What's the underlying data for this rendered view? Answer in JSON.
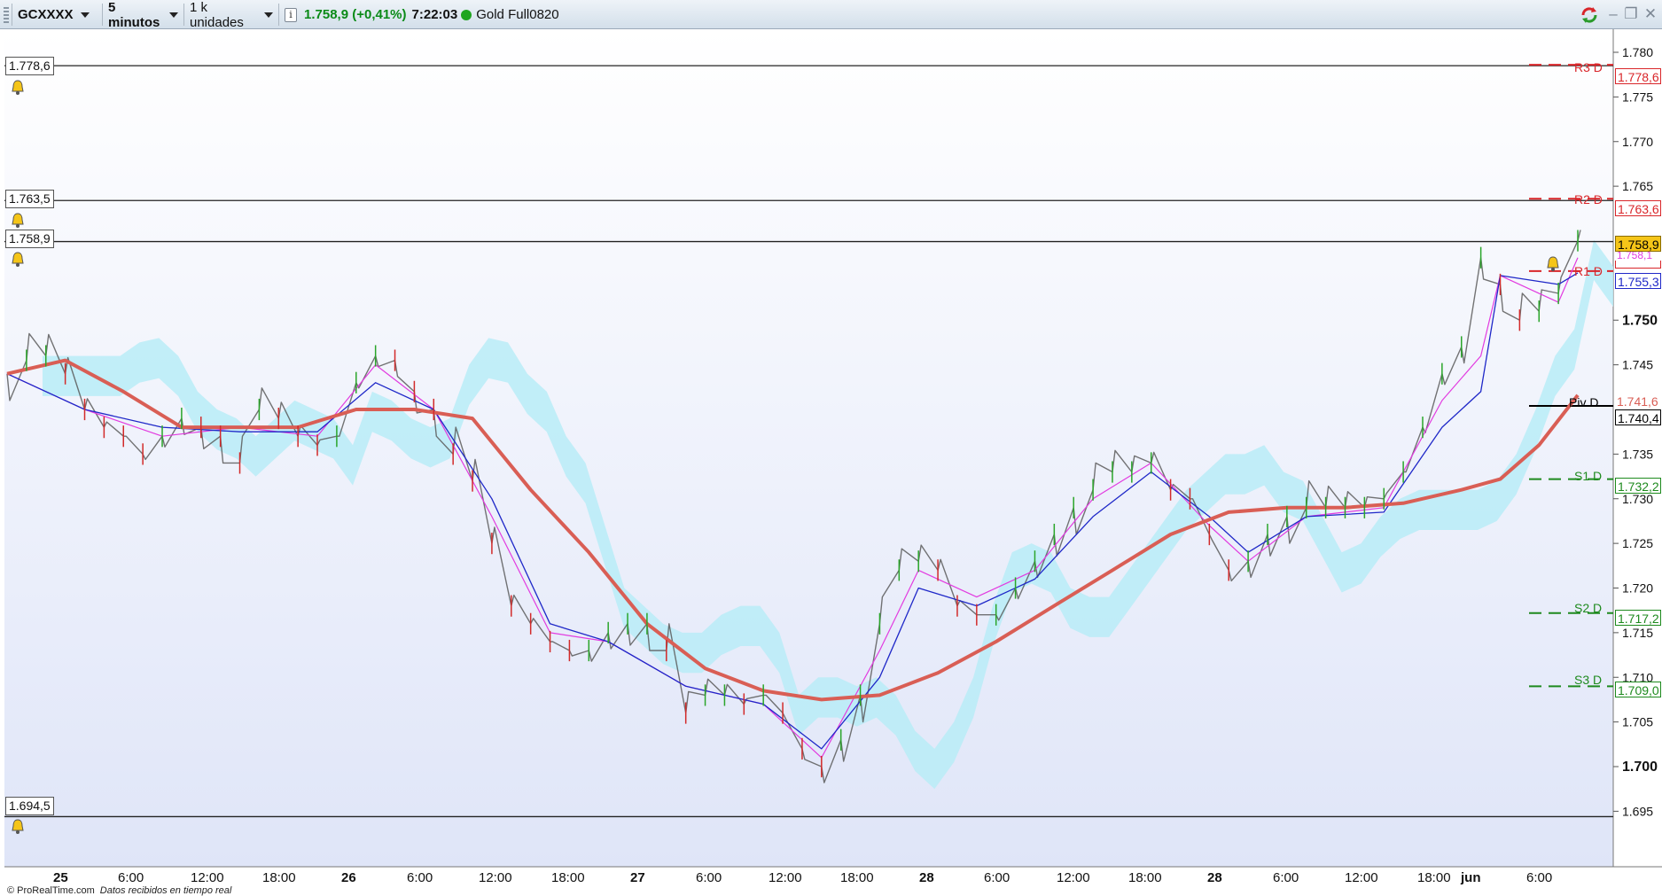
{
  "toolbar": {
    "symbol": "GCXXXX",
    "timeframe": "5 minutos",
    "units": "1 k unidades",
    "info_icon": "info-icon",
    "last_price": "1.758,9",
    "change": "(+0,41%)",
    "time": "7:22:03",
    "instrument": "Gold Full0820",
    "window_controls": [
      "refresh-icon",
      "minimize-icon",
      "restore-icon",
      "close-icon"
    ]
  },
  "horizontal_lines": [
    {
      "label": "1.778,6"
    },
    {
      "label": "1.763,5"
    },
    {
      "label": "1.758,9"
    },
    {
      "label": "1.694,5"
    }
  ],
  "pivots": [
    {
      "name": "R3 D",
      "value": "1.778,6",
      "color": "#d9262a"
    },
    {
      "name": "R2 D",
      "value": "1.763,6",
      "color": "#d9262a"
    },
    {
      "name": "R1 D",
      "value": "",
      "color": "#d9262a"
    },
    {
      "name": "Piv D",
      "value": "1.740,4",
      "color": "#000000"
    },
    {
      "name": "S1 D",
      "value": "1.732,2",
      "color": "#1e8a1e"
    },
    {
      "name": "S2 D",
      "value": "1.717,2",
      "color": "#1e8a1e"
    },
    {
      "name": "S3 D",
      "value": "1.709,0",
      "color": "#1e8a1e"
    }
  ],
  "price_tags": {
    "last": "1.758,9",
    "last_bg": "#f5c518",
    "secondary": "1.758,1",
    "kijun": "1.755,3",
    "ma": "1.741,6"
  },
  "chart_data": {
    "type": "line",
    "instrument": "GCXXXX",
    "interval": "5 minutos",
    "ylim": [
      1692,
      1783
    ],
    "y_ticks": [
      "1.780",
      "1.775",
      "1.770",
      "1.765",
      "1.750",
      "1.745",
      "1.735",
      "1.730",
      "1.725",
      "1.720",
      "1.715",
      "1.710",
      "1.705",
      "1.700",
      "1.695"
    ],
    "y_major_ticks": [
      "1.750",
      "1.700"
    ],
    "x_ticks": [
      "25",
      "6:00",
      "12:00",
      "18:00",
      "26",
      "6:00",
      "12:00",
      "18:00",
      "27",
      "6:00",
      "12:00",
      "18:00",
      "28",
      "6:00",
      "12:00",
      "18:00",
      "28",
      "6:00",
      "12:00",
      "18:00",
      "jun",
      "6:00"
    ],
    "x_day_ticks": [
      "25",
      "26",
      "27",
      "28",
      "jun"
    ],
    "series": [
      {
        "kind": "price",
        "color": "#5a5a5a",
        "points": [
          [
            0,
            1744
          ],
          [
            3,
            1745.5
          ],
          [
            6,
            1746
          ],
          [
            9,
            1744
          ],
          [
            12,
            1740
          ],
          [
            15,
            1738
          ],
          [
            18,
            1737
          ],
          [
            21,
            1735
          ],
          [
            24,
            1737
          ],
          [
            27,
            1739
          ],
          [
            30,
            1738
          ],
          [
            33,
            1737
          ],
          [
            36,
            1734
          ],
          [
            39,
            1740
          ],
          [
            42,
            1739
          ],
          [
            45,
            1737
          ],
          [
            48,
            1736
          ],
          [
            51,
            1737
          ],
          [
            54,
            1743
          ],
          [
            57,
            1746
          ],
          [
            60,
            1745.5
          ],
          [
            63,
            1742
          ],
          [
            66,
            1740
          ],
          [
            69,
            1735
          ],
          [
            72,
            1732
          ],
          [
            75,
            1725
          ],
          [
            78,
            1718
          ],
          [
            81,
            1716
          ],
          [
            84,
            1714
          ],
          [
            87,
            1713
          ],
          [
            90,
            1713
          ],
          [
            93,
            1715
          ],
          [
            96,
            1716
          ],
          [
            99,
            1716
          ],
          [
            102,
            1713
          ],
          [
            105,
            1706
          ],
          [
            108,
            1708
          ],
          [
            111,
            1708
          ],
          [
            114,
            1707
          ],
          [
            117,
            1708
          ],
          [
            120,
            1706
          ],
          [
            123,
            1702
          ],
          [
            126,
            1700
          ],
          [
            129,
            1703
          ],
          [
            132,
            1708
          ],
          [
            135,
            1716
          ],
          [
            138,
            1722
          ],
          [
            141,
            1723
          ],
          [
            144,
            1722
          ],
          [
            147,
            1718
          ],
          [
            150,
            1717
          ],
          [
            153,
            1717
          ],
          [
            156,
            1720
          ],
          [
            159,
            1723
          ],
          [
            162,
            1726
          ],
          [
            165,
            1729
          ],
          [
            168,
            1731
          ],
          [
            171,
            1733
          ],
          [
            174,
            1733
          ],
          [
            177,
            1734
          ],
          [
            180,
            1731
          ],
          [
            183,
            1730
          ],
          [
            186,
            1726
          ],
          [
            189,
            1722
          ],
          [
            192,
            1723
          ],
          [
            195,
            1726
          ],
          [
            198,
            1728
          ],
          [
            201,
            1729
          ],
          [
            204,
            1729
          ],
          [
            207,
            1729
          ],
          [
            210,
            1729
          ],
          [
            213,
            1730
          ],
          [
            216,
            1733
          ],
          [
            219,
            1738
          ],
          [
            222,
            1744
          ],
          [
            225,
            1747
          ],
          [
            228,
            1757
          ],
          [
            231,
            1754
          ],
          [
            234,
            1750
          ],
          [
            237,
            1751
          ],
          [
            240,
            1753
          ],
          [
            243,
            1758.9
          ]
        ]
      },
      {
        "kind": "tenkan",
        "color": "#e23be0",
        "points": [
          [
            0,
            1744
          ],
          [
            12,
            1740
          ],
          [
            24,
            1737
          ],
          [
            36,
            1738
          ],
          [
            48,
            1737
          ],
          [
            57,
            1745
          ],
          [
            66,
            1740
          ],
          [
            75,
            1728
          ],
          [
            84,
            1715
          ],
          [
            93,
            1714
          ],
          [
            105,
            1709
          ],
          [
            117,
            1707
          ],
          [
            126,
            1701
          ],
          [
            135,
            1713
          ],
          [
            141,
            1722
          ],
          [
            150,
            1719
          ],
          [
            159,
            1722
          ],
          [
            168,
            1730
          ],
          [
            177,
            1734
          ],
          [
            186,
            1727
          ],
          [
            192,
            1723
          ],
          [
            201,
            1728
          ],
          [
            213,
            1729
          ],
          [
            222,
            1741
          ],
          [
            228,
            1746
          ],
          [
            231,
            1755
          ],
          [
            240,
            1752
          ],
          [
            243,
            1757
          ]
        ]
      },
      {
        "kind": "kijun",
        "color": "#1f28c8",
        "points": [
          [
            0,
            1744
          ],
          [
            12,
            1740
          ],
          [
            24,
            1738
          ],
          [
            36,
            1737.5
          ],
          [
            48,
            1737.5
          ],
          [
            57,
            1743
          ],
          [
            66,
            1740
          ],
          [
            75,
            1730
          ],
          [
            84,
            1716
          ],
          [
            93,
            1714
          ],
          [
            105,
            1709
          ],
          [
            117,
            1707
          ],
          [
            126,
            1702
          ],
          [
            135,
            1710
          ],
          [
            141,
            1720
          ],
          [
            150,
            1718
          ],
          [
            159,
            1721
          ],
          [
            168,
            1728
          ],
          [
            177,
            1733
          ],
          [
            186,
            1728
          ],
          [
            192,
            1724
          ],
          [
            201,
            1728
          ],
          [
            213,
            1728.5
          ],
          [
            222,
            1738
          ],
          [
            228,
            1742
          ],
          [
            231,
            1755
          ],
          [
            240,
            1754
          ],
          [
            243,
            1755.3
          ]
        ]
      },
      {
        "kind": "moving_average",
        "color": "#d95e55",
        "points": [
          [
            0,
            1744
          ],
          [
            9,
            1745.5
          ],
          [
            18,
            1742
          ],
          [
            27,
            1738
          ],
          [
            36,
            1738
          ],
          [
            45,
            1738
          ],
          [
            54,
            1740
          ],
          [
            63,
            1740
          ],
          [
            72,
            1739
          ],
          [
            81,
            1731
          ],
          [
            90,
            1724
          ],
          [
            99,
            1716
          ],
          [
            108,
            1711
          ],
          [
            117,
            1708.5
          ],
          [
            126,
            1707.5
          ],
          [
            135,
            1708
          ],
          [
            144,
            1710.5
          ],
          [
            153,
            1714
          ],
          [
            162,
            1718
          ],
          [
            171,
            1722
          ],
          [
            180,
            1726
          ],
          [
            189,
            1728.5
          ],
          [
            198,
            1729
          ],
          [
            207,
            1729
          ],
          [
            216,
            1729.5
          ],
          [
            225,
            1731
          ],
          [
            231,
            1732.2
          ],
          [
            237,
            1736
          ],
          [
            243,
            1741.6
          ]
        ]
      }
    ],
    "pivot_levels": {
      "R3 D": 1778.6,
      "R2 D": 1763.6,
      "R1 D": 1755.5,
      "Piv D": 1740.4,
      "S1 D": 1732.2,
      "S2 D": 1717.2,
      "S3 D": 1709.0
    },
    "horizontal_levels": [
      1778.6,
      1763.5,
      1758.9,
      1694.5
    ]
  },
  "footer": {
    "copyright": "© ProRealTime.com",
    "status": "Datos recibidos en tiempo real"
  }
}
